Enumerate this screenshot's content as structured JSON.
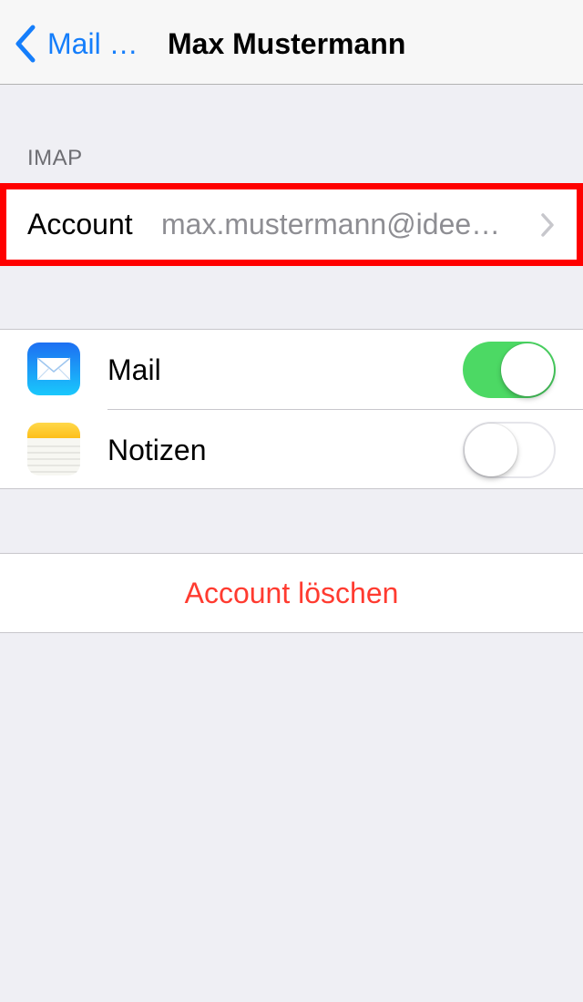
{
  "navbar": {
    "back_label": "Mail …",
    "title": "Max Mustermann"
  },
  "imap_section": {
    "header": "IMAP",
    "account_label": "Account",
    "account_value": "max.mustermann@idee…"
  },
  "services": [
    {
      "label": "Mail",
      "icon": "mail-app-icon",
      "enabled": true
    },
    {
      "label": "Notizen",
      "icon": "notes-app-icon",
      "enabled": false
    }
  ],
  "delete_label": "Account löschen",
  "colors": {
    "accent": "#157efb",
    "toggle_on": "#4cd964",
    "destructive": "#ff3b30",
    "highlight_border": "#ff0000"
  }
}
